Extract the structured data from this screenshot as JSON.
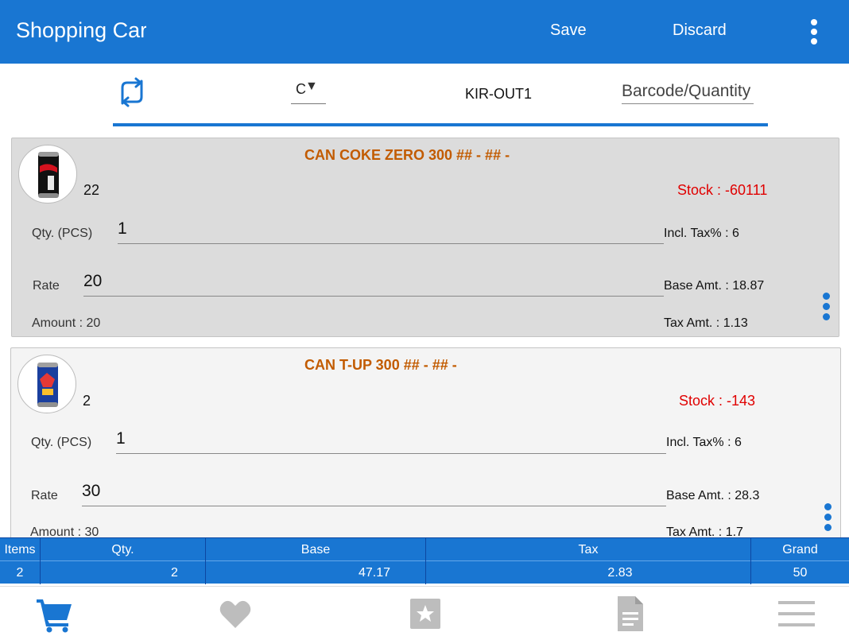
{
  "appbar": {
    "title": "Shopping Cart",
    "save_label": "Save",
    "discard_label": "Discard"
  },
  "toolbar": {
    "dropdown_value": "C",
    "outlet": "KIR-OUT1",
    "barcode_placeholder": "Barcode/Quantity"
  },
  "items": [
    {
      "name": "CAN COKE ZERO 300 ## - ## -",
      "code": "22",
      "stock": "Stock : -60111",
      "qty_label": "Qty. (PCS)",
      "qty": "1",
      "rate_label": "Rate",
      "rate": "20",
      "amount": "Amount : 20",
      "incl_tax": "Incl. Tax% : 6",
      "base_amt": "Base Amt. : 18.87",
      "tax_amt": "Tax Amt. : 1.13"
    },
    {
      "name": "CAN T-UP 300 ## - ## -",
      "code": "2",
      "stock": "Stock : -143",
      "qty_label": "Qty. (PCS)",
      "qty": "1",
      "rate_label": "Rate",
      "rate": "30",
      "amount": "Amount : 30",
      "incl_tax": "Incl. Tax% : 6",
      "base_amt": "Base Amt. : 28.3",
      "tax_amt": "Tax Amt. : 1.7"
    }
  ],
  "totals": {
    "headers": [
      "Items",
      "Qty.",
      "Base",
      "Tax",
      "Grand"
    ],
    "values": [
      "2",
      "2",
      "47.17",
      "2.83",
      "50"
    ]
  },
  "bottom_nav": {
    "icons": [
      "cart-icon",
      "heart-icon",
      "star-icon",
      "document-icon",
      "menu-icon"
    ]
  },
  "colors": {
    "primary": "#1976d2",
    "item_name": "#c25b00",
    "stock": "#e00000",
    "card_selected": "#dcdcdc",
    "card_normal": "#f4f4f4",
    "nav_inactive": "#bdbdbd"
  }
}
